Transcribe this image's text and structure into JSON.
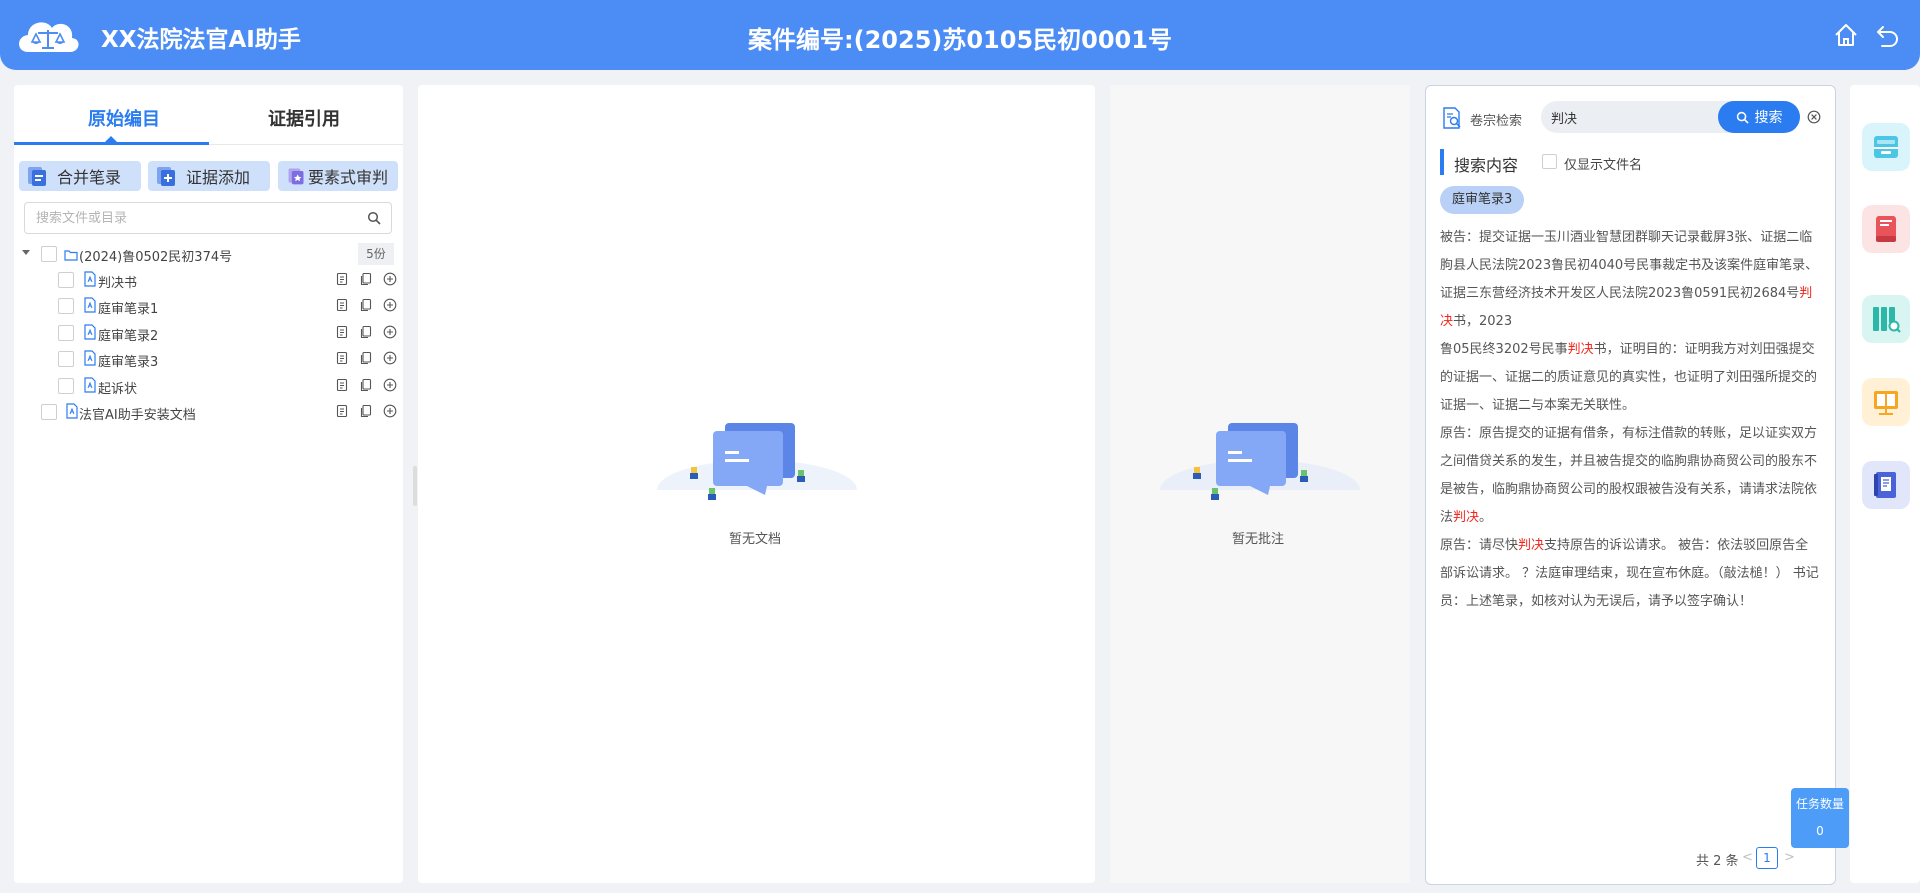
{
  "header": {
    "app_title": "XX法院法官AI助手",
    "case_title": "案件编号:(2025)苏0105民初0001号"
  },
  "left": {
    "tabs": [
      "原始编目",
      "证据引用"
    ],
    "toolbar": [
      "合并笔录",
      "证据添加",
      "要素式审判"
    ],
    "search_placeholder": "搜索文件或目录",
    "folder": {
      "label": "(2024)鲁0502民初374号",
      "count": "5份"
    },
    "files": [
      "判决书",
      "庭审笔录1",
      "庭审笔录2",
      "庭审笔录3",
      "起诉状"
    ],
    "root_file": "法官AI助手安装文档"
  },
  "middle": {
    "empty_text": "暂无文档"
  },
  "notes": {
    "empty_text": "暂无批注"
  },
  "right": {
    "header_label": "卷宗检索",
    "search_value": "判决",
    "search_button": "搜索",
    "section_title": "搜索内容",
    "only_filename": "仅显示文件名",
    "chip": "庭审笔录3",
    "paragraphs": [
      [
        {
          "t": "被告：提交证据一玉川酒业智慧团群聊天记录截屏3张、证据二临朐县人民法院2023鲁民初4040号民事裁定书及该案件庭审笔录、证据三东营经济技术开发区人民法院2023鲁0591民初2684号"
        },
        {
          "t": "判决",
          "h": true
        },
        {
          "t": "书，2023"
        }
      ],
      [
        {
          "t": "鲁05民终3202号民事"
        },
        {
          "t": "判决",
          "h": true
        },
        {
          "t": "书，证明目的：证明我方对刘田强提交的证据一、证据二的质证意见的真实性，也证明了刘田强所提交的证据一、证据二与本案无关联性。"
        }
      ],
      [
        {
          "t": "原告：原告提交的证据有借条，有标注借款的转账，足以证实双方之间借贷关系的发生，并且被告提交的临朐鼎协商贸公司的股东不是被告，临朐鼎协商贸公司的股权跟被告没有关系，请请求法院依法"
        },
        {
          "t": "判决",
          "h": true
        },
        {
          "t": "。"
        }
      ],
      [
        {
          "t": "原告：请尽快"
        },
        {
          "t": "判决",
          "h": true
        },
        {
          "t": "支持原告的诉讼请求。 被告：依法驳回原告全部诉讼请求。 ？法庭审理结束，现在宣布休庭。（敲法槌！） 书记员：上述笔录，如核对认为无误后，请予以签字确认！"
        }
      ]
    ],
    "pager": {
      "total": "共 2 条",
      "prev": "<",
      "current": "1",
      "next": ">"
    }
  },
  "task": {
    "label": "任务数量",
    "value": "0"
  },
  "colors": {
    "primary": "#4c8cf5",
    "accent": "#2b7cf0",
    "highlight": "#f0271d"
  },
  "side_icons": [
    "inbox-tray-icon",
    "red-book-icon",
    "binder-search-icon",
    "presentation-board-icon",
    "judgment-document-icon"
  ]
}
